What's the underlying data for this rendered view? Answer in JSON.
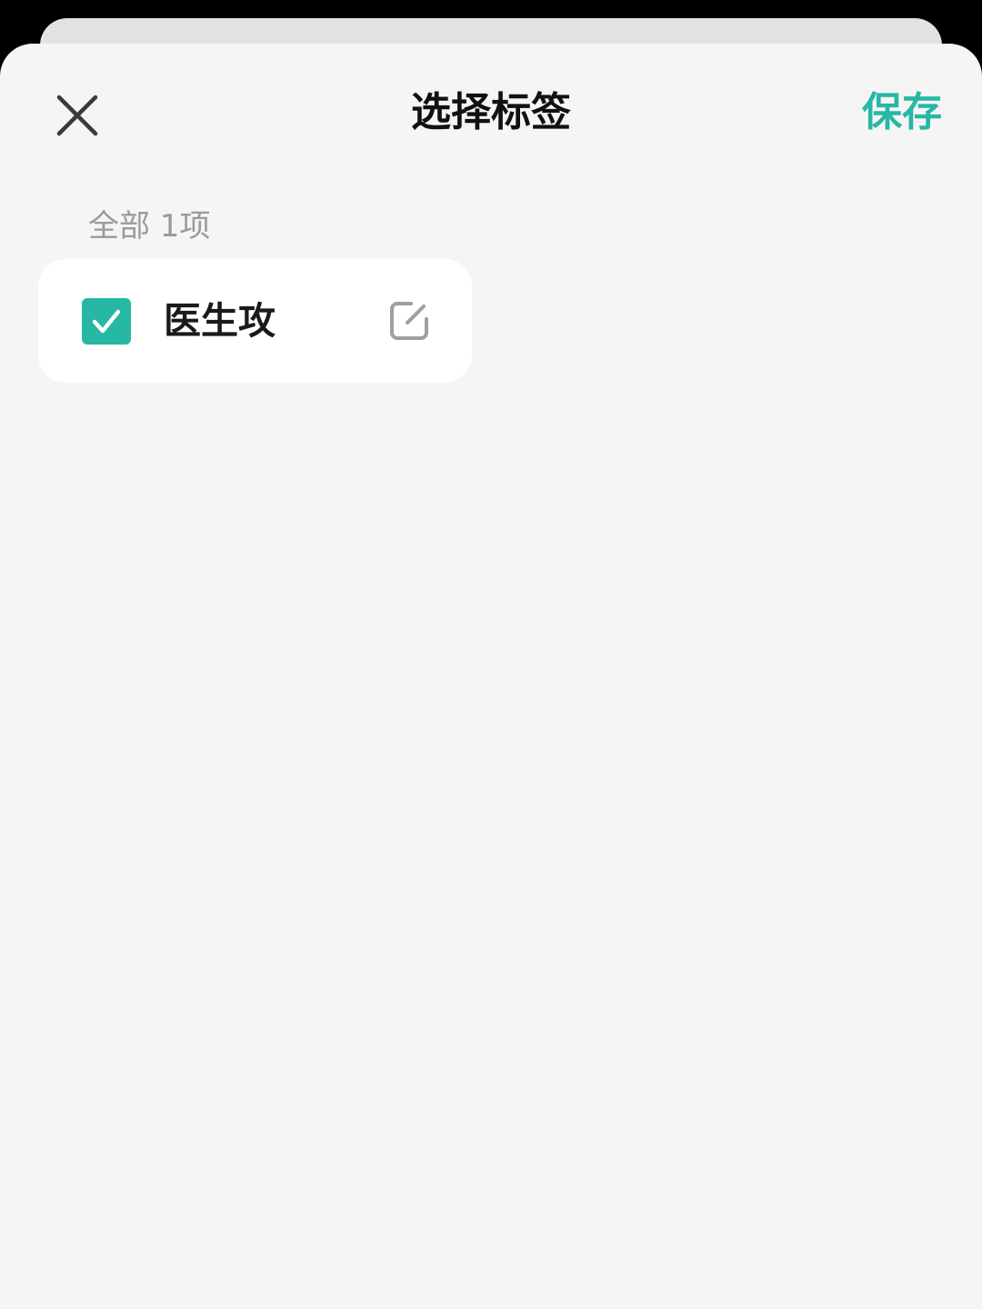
{
  "header": {
    "title": "选择标签",
    "save_label": "保存",
    "close_icon": "close-icon"
  },
  "section": {
    "label": "全部 1项"
  },
  "tags": [
    {
      "label": "医生攻",
      "checked": true,
      "edit_icon": "edit-icon"
    }
  ],
  "colors": {
    "accent": "#27b7a5",
    "sheet_background": "#f5f5f5",
    "card_background": "#ffffff",
    "muted_text": "#9a9a9a",
    "edit_icon": "#9e9ea6"
  }
}
